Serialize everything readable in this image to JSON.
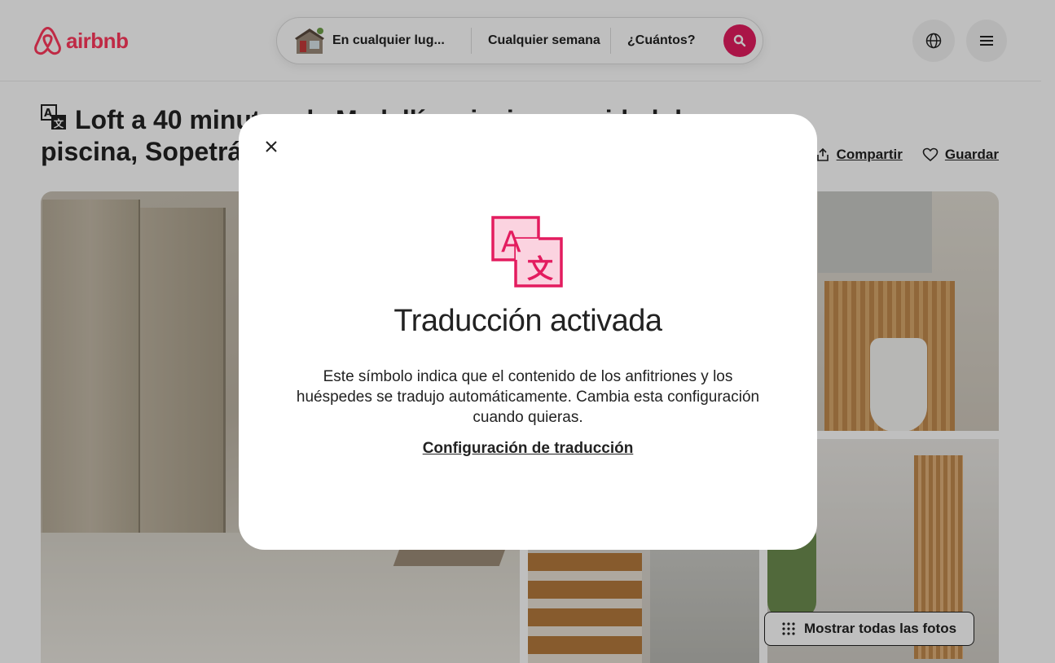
{
  "header": {
    "logo_text": "airbnb",
    "brand_color": "#ff385c",
    "search": {
      "where": "En cualquier lug...",
      "when": "Cualquier semana",
      "who": "¿Cuántos?"
    }
  },
  "listing": {
    "title_line1": "Loft a 40 minutos de Medellín, piscina y unidad de",
    "title_line2": "piscina, Sopetrán",
    "share_label": "Compartir",
    "save_label": "Guardar",
    "show_all_photos": "Mostrar todas las fotos"
  },
  "modal": {
    "title": "Traducción activada",
    "body": "Este símbolo indica que el contenido de los anfitriones y los huéspedes se tradujo automáticamente. Cambia esta configuración cuando quieras.",
    "link": "Configuración de traducción",
    "icon": "translate-icon",
    "accent_color": "#e31c5f"
  }
}
